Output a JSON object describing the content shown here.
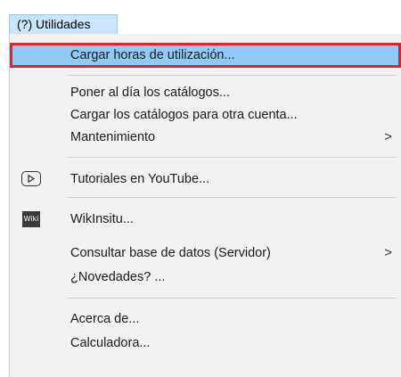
{
  "menubar": {
    "title": "(?) Utilidades"
  },
  "menu": {
    "items": [
      {
        "label": "Cargar horas de utilización...",
        "highlighted": true
      },
      {
        "label": "Poner al día los catálogos..."
      },
      {
        "label": "Cargar los catálogos para otra cuenta..."
      },
      {
        "label": "Mantenimiento",
        "submenu_arrow": ">"
      },
      {
        "label": "Tutoriales en YouTube...",
        "icon": "youtube-play-icon"
      },
      {
        "label": "WikInsitu...",
        "icon": "wiki-icon",
        "icon_text": "Wiki"
      },
      {
        "label": "Consultar base de datos (Servidor)",
        "submenu_arrow": ">"
      },
      {
        "label": "¿Novedades? ..."
      },
      {
        "label": "Acerca de..."
      },
      {
        "label": "Calculadora..."
      }
    ]
  },
  "colors": {
    "highlight_fill": "#91c9f7",
    "highlight_border": "#d7262c",
    "menu_background": "#f2f2f2",
    "menubar_active": "#cce4f7"
  }
}
